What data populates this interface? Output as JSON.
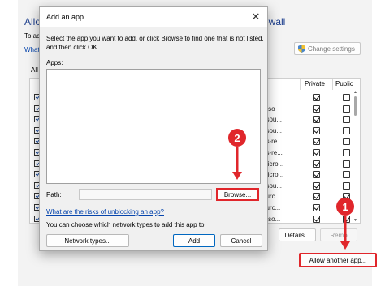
{
  "background_window": {
    "title_left": "Allo",
    "title_right": "ewall",
    "subtitle": "To ac",
    "link": "What",
    "change_settings_label": "Change settings",
    "allowed_label": "All",
    "columns": {
      "private": "Private",
      "public": "Public"
    },
    "rows": [
      {
        "name": "",
        "private": true,
        "public": false
      },
      {
        "name": "reso",
        "private": true,
        "public": false
      },
      {
        "name": "esou...",
        "private": true,
        "public": false
      },
      {
        "name": "esou...",
        "private": true,
        "public": false
      },
      {
        "name": "ns-re...",
        "private": true,
        "public": false
      },
      {
        "name": "ns-re...",
        "private": true,
        "public": false
      },
      {
        "name": "Micro...",
        "private": true,
        "public": false
      },
      {
        "name": "Micro...",
        "private": true,
        "public": false
      },
      {
        "name": "esou...",
        "private": true,
        "public": false
      },
      {
        "name": "ourc...",
        "private": true,
        "public": true
      },
      {
        "name": "ourc...",
        "private": true,
        "public": true
      },
      {
        "name": "reso...",
        "private": true,
        "public": true
      }
    ],
    "details_label": "Details...",
    "remove_label": "Remo",
    "allow_another_label": "Allow another app..."
  },
  "dialog": {
    "title": "Add an app",
    "close_glyph": "✕",
    "instructions": "Select the app you want to add, or click Browse to find one that is not listed, and then click OK.",
    "apps_label": "Apps:",
    "path_label": "Path:",
    "path_value": "",
    "browse_label": "Browse...",
    "risk_link": "What are the risks of unblocking an app?",
    "network_text": "You can choose which network types to add this app to.",
    "network_types_label": "Network types...",
    "add_label": "Add",
    "cancel_label": "Cancel"
  },
  "annotations": {
    "marker1": "1",
    "marker2": "2",
    "accent_color": "#e0262b"
  }
}
